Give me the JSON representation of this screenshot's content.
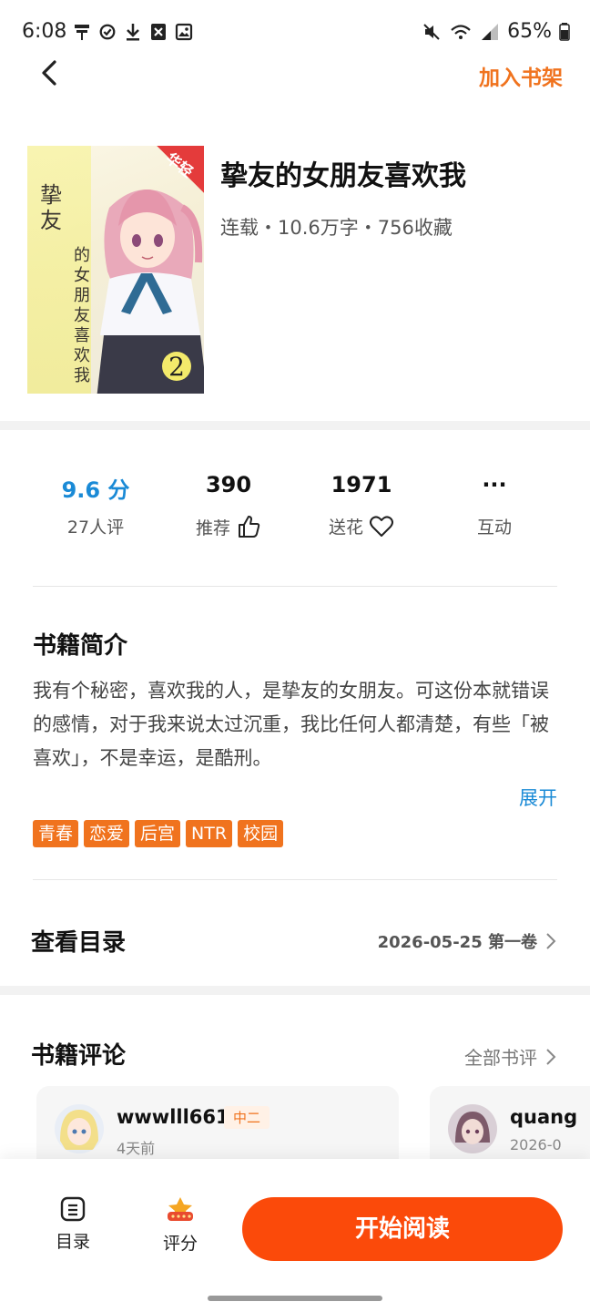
{
  "status_bar": {
    "time": "6:08",
    "battery": "65%"
  },
  "header": {
    "add_to_shelf": "加入书架"
  },
  "book": {
    "title": "挚友的女朋友喜欢我",
    "meta": "连载・10.6万字・756收藏",
    "cover": {
      "ribbon": "华轻",
      "title_large": "挚友",
      "title_small": "的女朋友喜欢我",
      "volume": "2"
    }
  },
  "stats": {
    "score": "9.6 分",
    "raters": "27人评",
    "recommend_count": "390",
    "recommend_label": "推荐",
    "flower_count": "1971",
    "flower_label": "送花",
    "more_icon": "···",
    "interact_label": "互动"
  },
  "intro": {
    "title": "书籍简介",
    "text": "我有个秘密，喜欢我的人，是挚友的女朋友。可这份本就错误的感情，对于我来说太过沉重，我比任何人都清楚，有些「被喜欢」，不是幸运，是酷刑。",
    "expand": "展开",
    "tags": [
      "青春",
      "恋爱",
      "后宫",
      "NTR",
      "校园"
    ]
  },
  "catalog": {
    "title": "查看目录",
    "latest": "2026-05-25 第一卷"
  },
  "reviews": {
    "title": "书籍评论",
    "all_label": "全部书评",
    "items": [
      {
        "name": "wwwlll661",
        "badge": "中二",
        "time": "4天前"
      },
      {
        "name": "quang",
        "time": "2026-0"
      }
    ]
  },
  "bottom_bar": {
    "toc_label": "目录",
    "rate_label": "评分",
    "read_label": "开始阅读"
  },
  "colors": {
    "accent_orange": "#f0731e",
    "read_button": "#fb4a0a",
    "score_blue": "#1a8ad6"
  }
}
